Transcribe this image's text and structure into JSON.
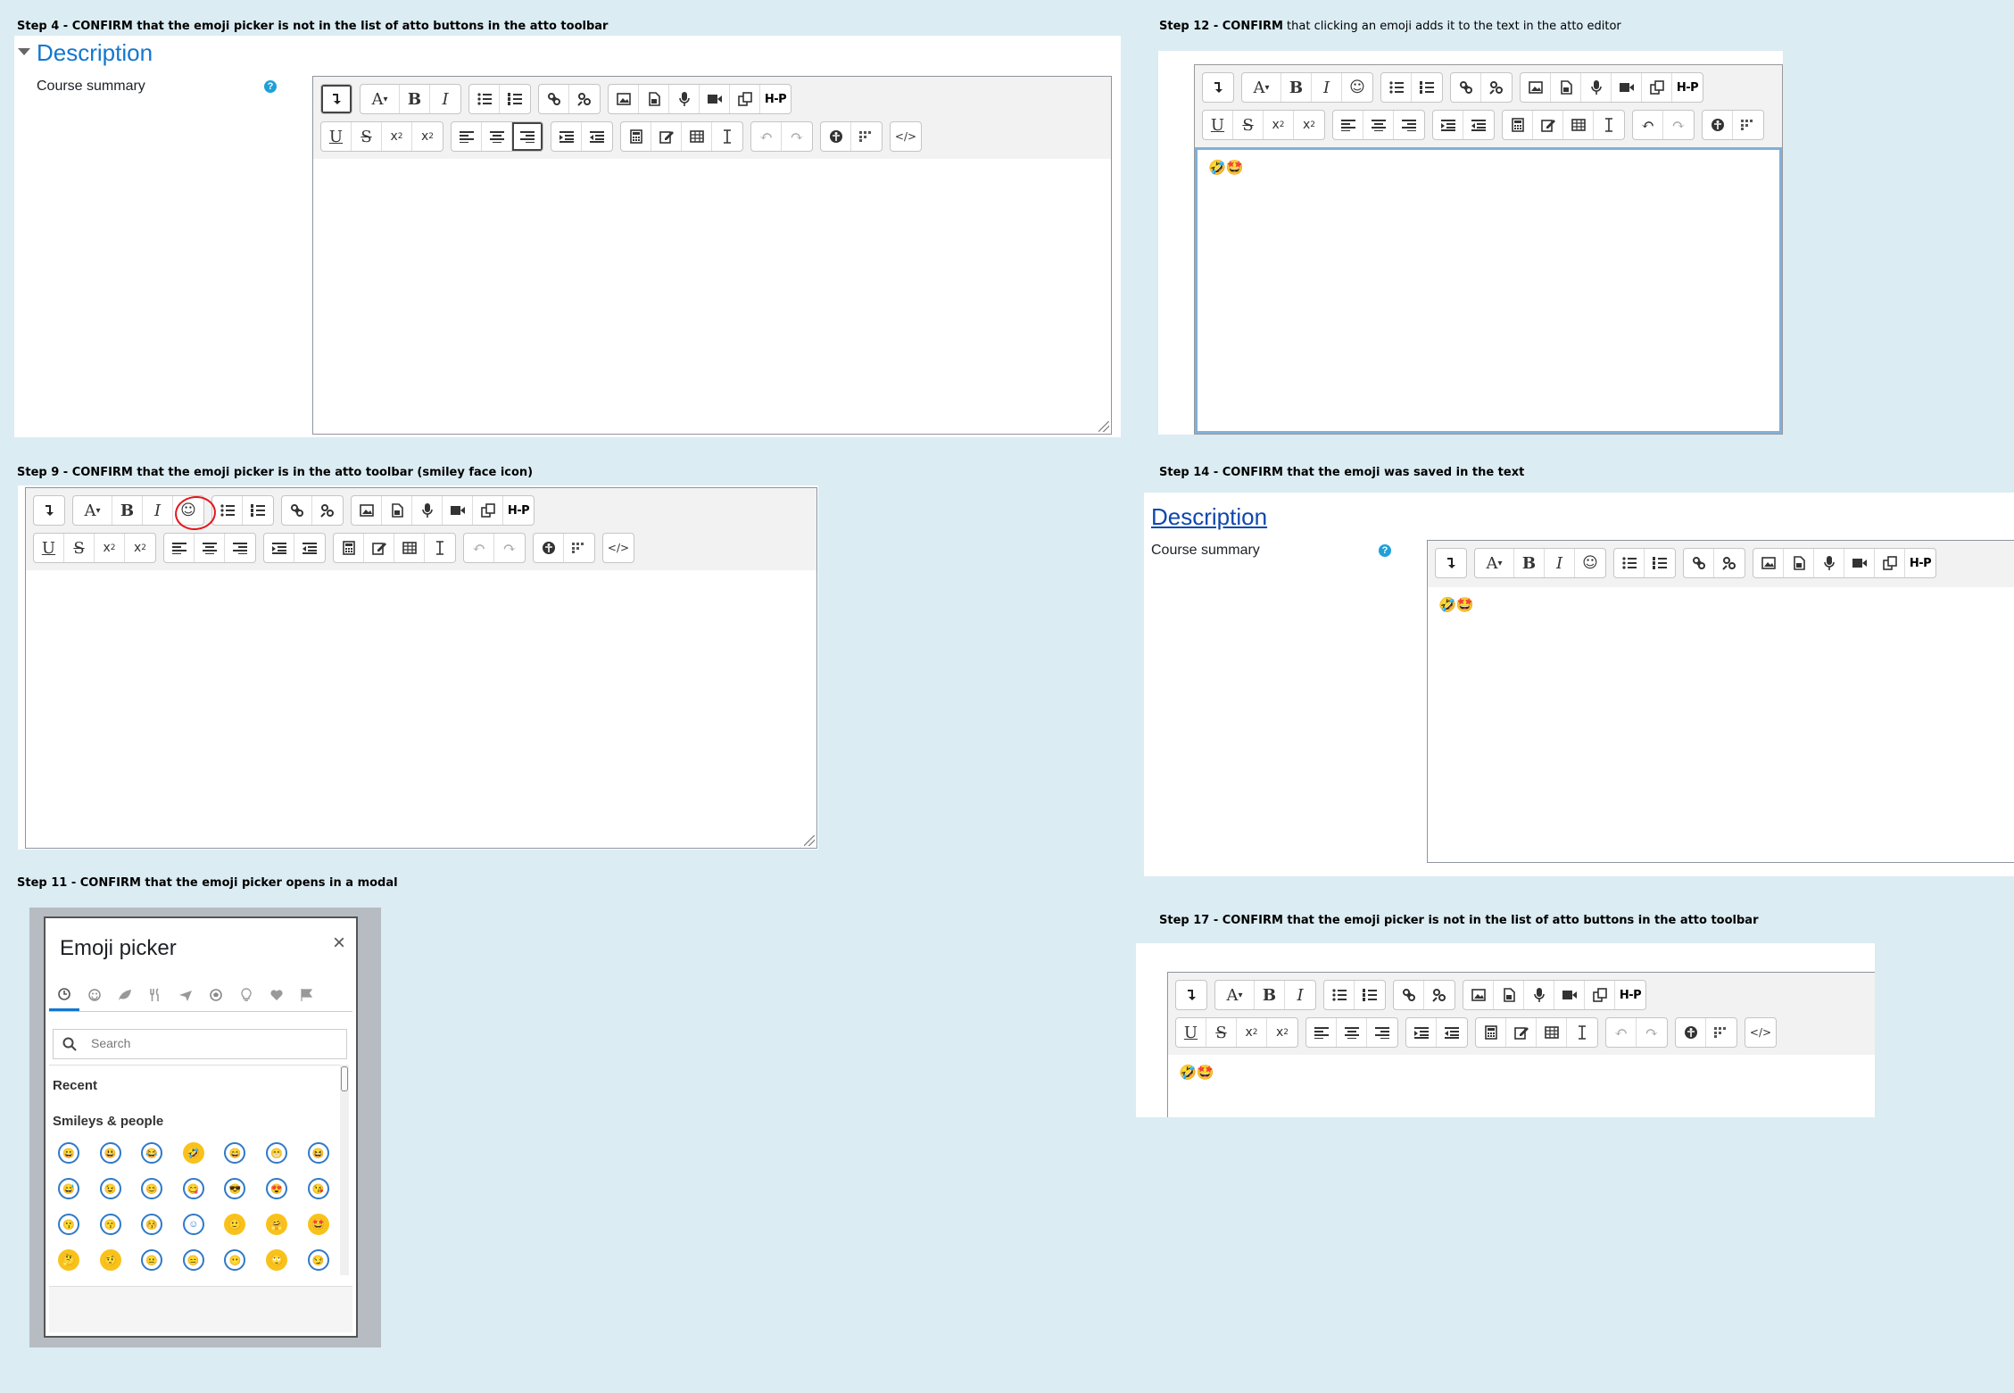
{
  "captions": {
    "step4": {
      "bold": "Step 4 - CONFIRM that the emoji picker is not in the list of atto buttons in the atto toolbar",
      "rest": ""
    },
    "step12": {
      "bold": "Step 12 - CONFIRM",
      "rest": " that clicking an emoji adds it to the text in the atto editor"
    },
    "step9": {
      "bold": "Step 9 - CONFIRM that the emoji picker is in the atto toolbar (smiley face icon)",
      "rest": ""
    },
    "step14": {
      "bold": "Step 14 - CONFIRM that the emoji was saved in the text",
      "rest": ""
    },
    "step11": {
      "bold": "Step 11 - CONFIRM that the emoji picker opens in a modal",
      "rest": ""
    },
    "step17": {
      "bold": "Step 17 - CONFIRM that the emoji picker is not in the list of atto buttons in the atto toolbar",
      "rest": ""
    }
  },
  "form": {
    "section_title": "Description",
    "field_label": "Course summary",
    "help_glyph": "?"
  },
  "editor_text": "🤣🤩",
  "modal": {
    "title": "Emoji picker",
    "close": "×",
    "search_placeholder": "Search",
    "recent_label": "Recent",
    "smileys_label": "Smileys & people",
    "categories": [
      "clock-icon",
      "smiley-icon",
      "leaf-icon",
      "fork-knife-icon",
      "plane-icon",
      "soccer-icon",
      "bulb-icon",
      "heart-icon",
      "flag-icon"
    ],
    "emojis": [
      "😀",
      "😃",
      "😂",
      "🤣",
      "😄",
      "😁",
      "😆",
      "😅",
      "😉",
      "😊",
      "😋",
      "😎",
      "😍",
      "😘",
      "😗",
      "😙",
      "😚",
      "☺",
      "🙂",
      "🤗",
      "🤩",
      "🤔",
      "🤨",
      "😐",
      "😑",
      "😶",
      "🙄",
      "😏"
    ]
  },
  "colors": {
    "accent": "#1177d1",
    "annotation": "#e3171b",
    "background": "#dbecf3"
  }
}
